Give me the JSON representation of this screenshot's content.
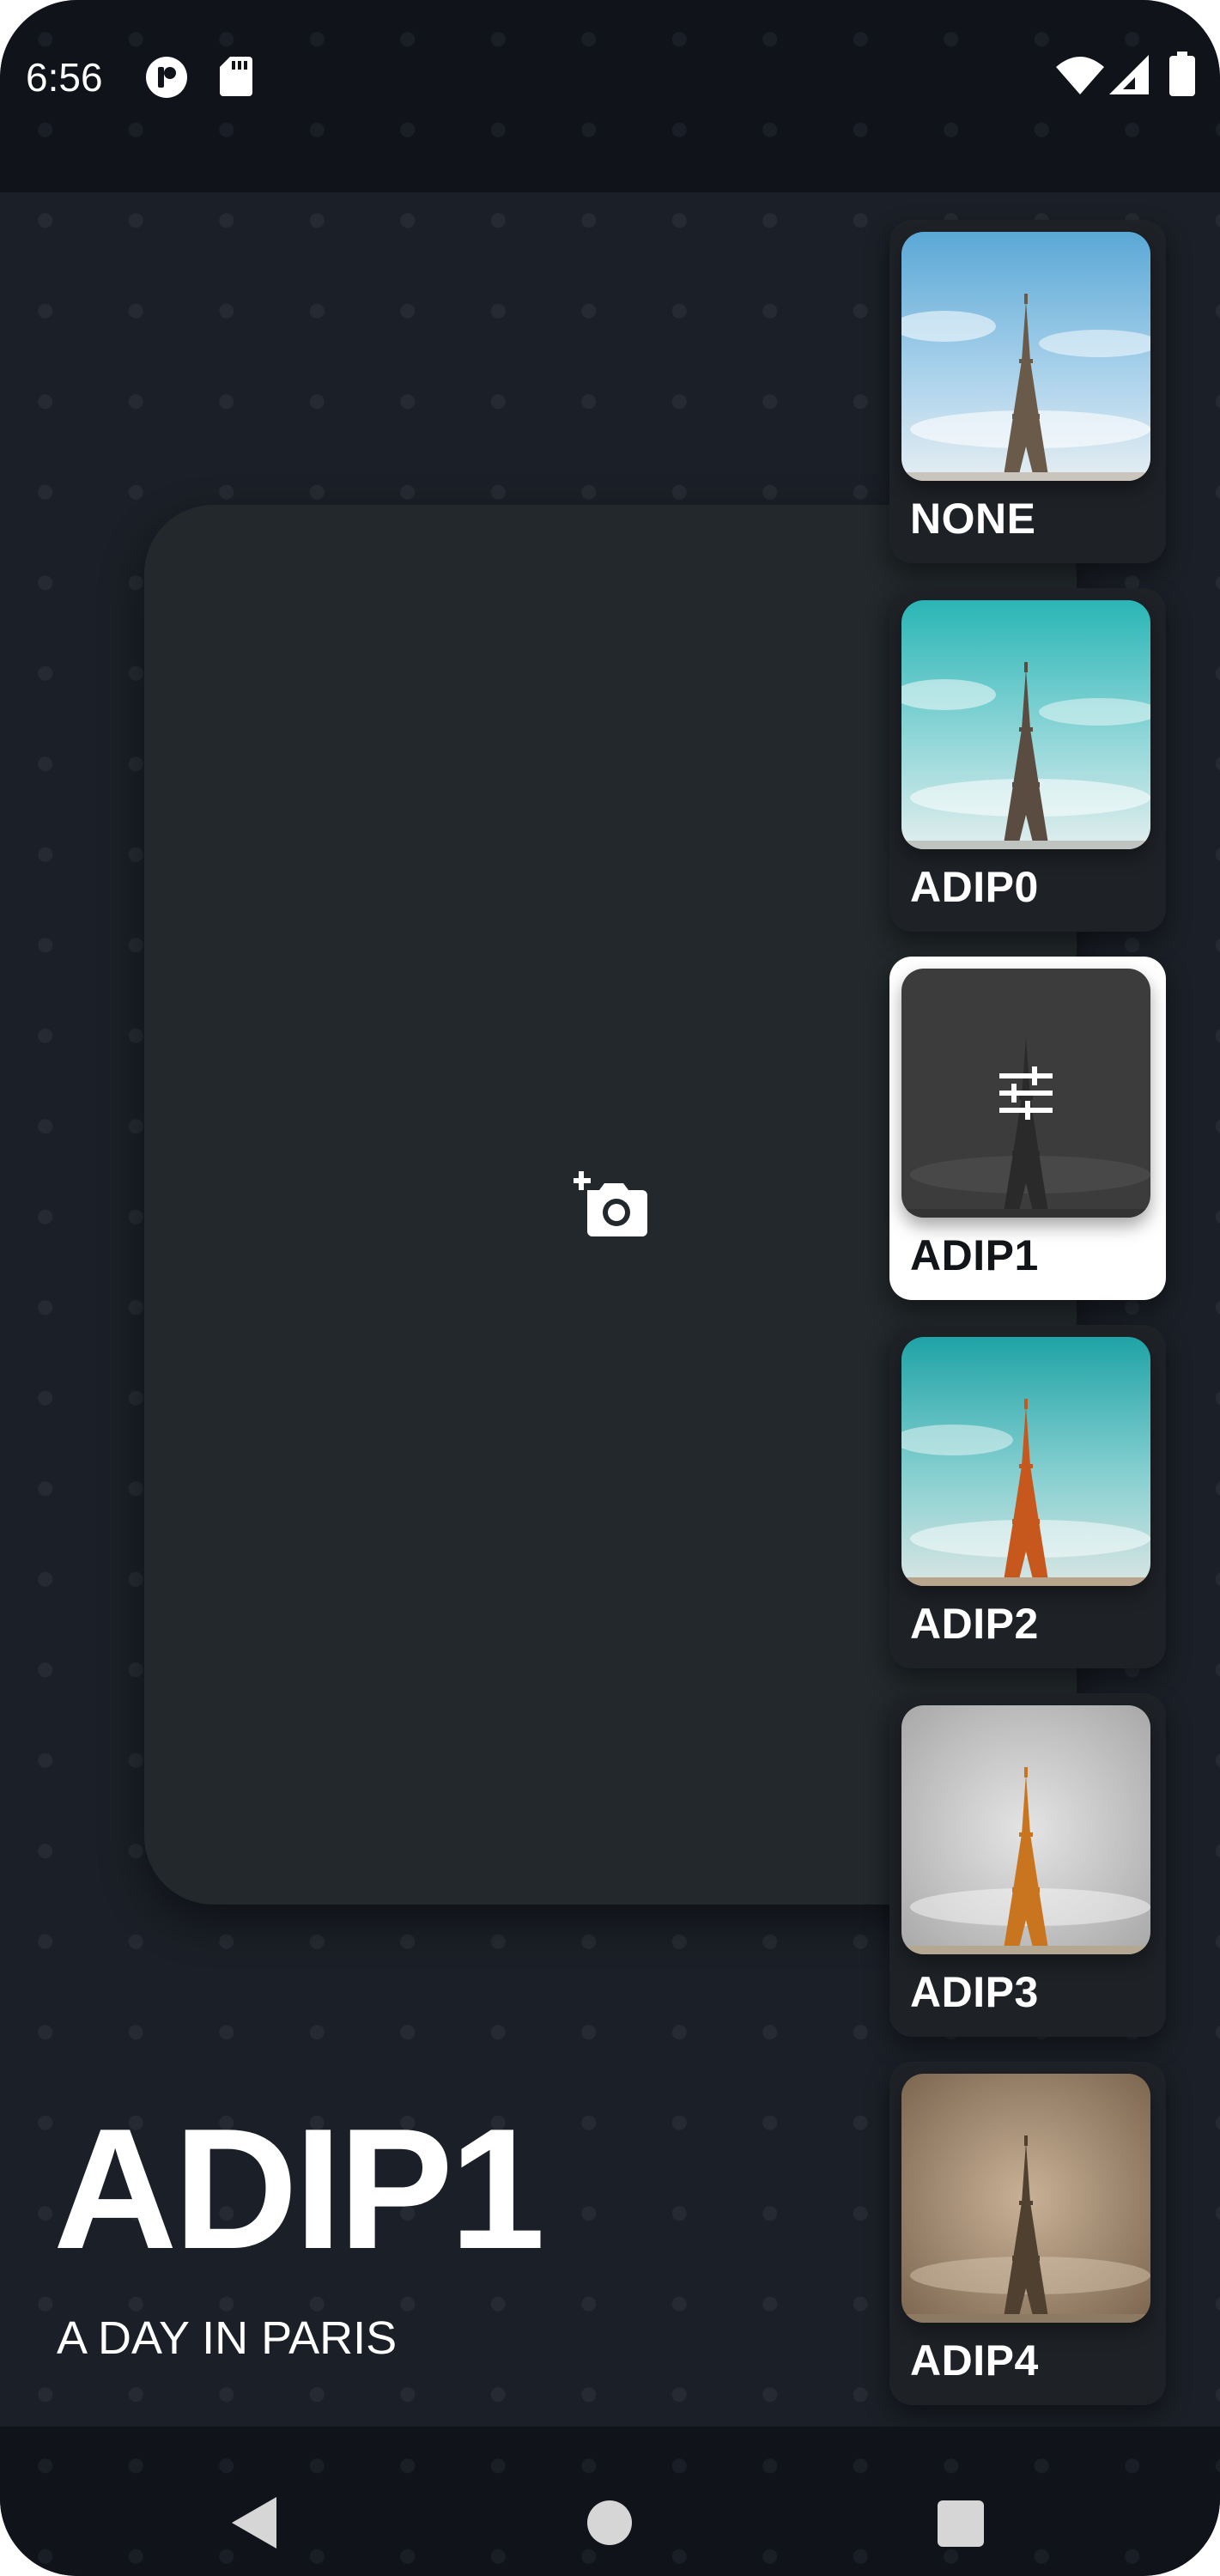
{
  "status_bar": {
    "time": "6:56",
    "left_icons": [
      "app-notification-icon",
      "sd-card-icon"
    ],
    "right_icons": [
      "wifi-icon",
      "cellular-signal-icon",
      "battery-icon"
    ]
  },
  "canvas": {
    "add_photo_icon": "add-a-photo-icon"
  },
  "filters": [
    {
      "label": "NONE",
      "selected": false,
      "tint": "none"
    },
    {
      "label": "ADIP0",
      "selected": false,
      "tint": "teal"
    },
    {
      "label": "ADIP1",
      "selected": true,
      "tint": "dark",
      "icon": "tune-icon"
    },
    {
      "label": "ADIP2",
      "selected": false,
      "tint": "teal-orange"
    },
    {
      "label": "ADIP3",
      "selected": false,
      "tint": "gray-orange"
    },
    {
      "label": "ADIP4",
      "selected": false,
      "tint": "sepia"
    }
  ],
  "current_filter": {
    "name": "ADIP1",
    "description": "A DAY IN PARIS"
  },
  "nav_bar": {
    "buttons": [
      "back-icon",
      "home-icon",
      "recents-icon"
    ]
  },
  "colors": {
    "background": "#1b1f27",
    "card": "#22282b",
    "selected_card": "#ffffff",
    "text": "#ffffff"
  }
}
